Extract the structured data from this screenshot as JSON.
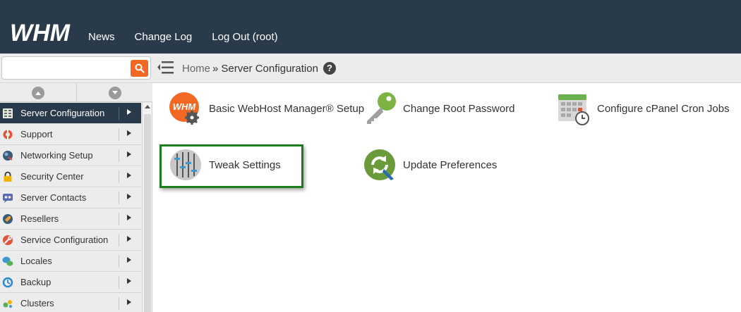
{
  "app": {
    "logo_text": "WHM",
    "nav": [
      {
        "label": "News"
      },
      {
        "label": "Change Log"
      },
      {
        "label": "Log Out (root)"
      }
    ]
  },
  "search": {
    "value": "",
    "placeholder": ""
  },
  "breadcrumb": {
    "home": "Home",
    "separator": "»",
    "current": "Server Configuration",
    "help": "?"
  },
  "sidebar": {
    "items": [
      {
        "label": "Server Configuration",
        "icon": "server-config-icon",
        "active": true
      },
      {
        "label": "Support",
        "icon": "support-icon"
      },
      {
        "label": "Networking Setup",
        "icon": "networking-icon"
      },
      {
        "label": "Security Center",
        "icon": "lock-icon"
      },
      {
        "label": "Server Contacts",
        "icon": "contacts-icon"
      },
      {
        "label": "Resellers",
        "icon": "resellers-icon"
      },
      {
        "label": "Service Configuration",
        "icon": "wrench-icon"
      },
      {
        "label": "Locales",
        "icon": "locales-icon"
      },
      {
        "label": "Backup",
        "icon": "backup-icon"
      },
      {
        "label": "Clusters",
        "icon": "clusters-icon"
      }
    ]
  },
  "tiles": [
    {
      "label": "Basic WebHost Manager® Setup",
      "icon": "whm-setup-icon"
    },
    {
      "label": "Change Root Password",
      "icon": "key-icon"
    },
    {
      "label": "Configure cPanel Cron Jobs",
      "icon": "calendar-clock-icon"
    },
    {
      "label": "Tweak Settings",
      "icon": "sliders-icon",
      "highlighted": true
    },
    {
      "label": "Update Preferences",
      "icon": "update-icon"
    }
  ],
  "colors": {
    "topbar": "#293a4a",
    "accent_orange": "#f26822",
    "highlight_green": "#1b7d1b"
  }
}
